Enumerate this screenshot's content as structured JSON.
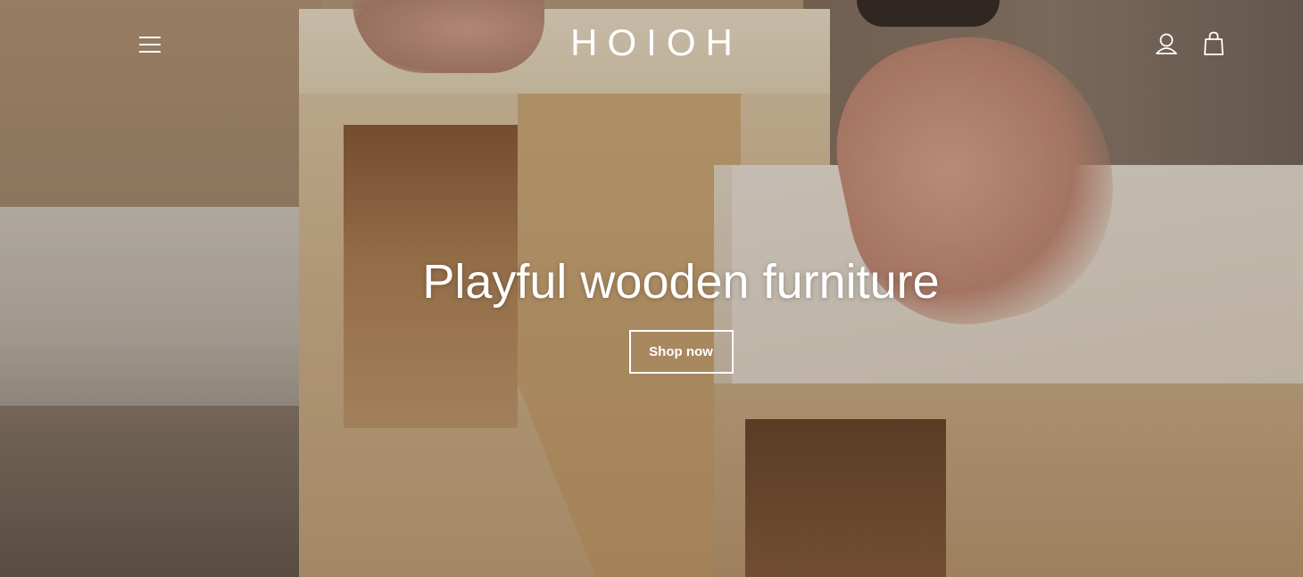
{
  "header": {
    "logo": "HOIOH",
    "menu_icon": "hamburger-menu-icon",
    "account_icon": "user-icon",
    "cart_icon": "shopping-bag-icon"
  },
  "hero": {
    "title": "Playful wooden furniture",
    "cta_label": "Shop now"
  },
  "colors": {
    "text": "#ffffff",
    "button_border": "#ffffff"
  }
}
